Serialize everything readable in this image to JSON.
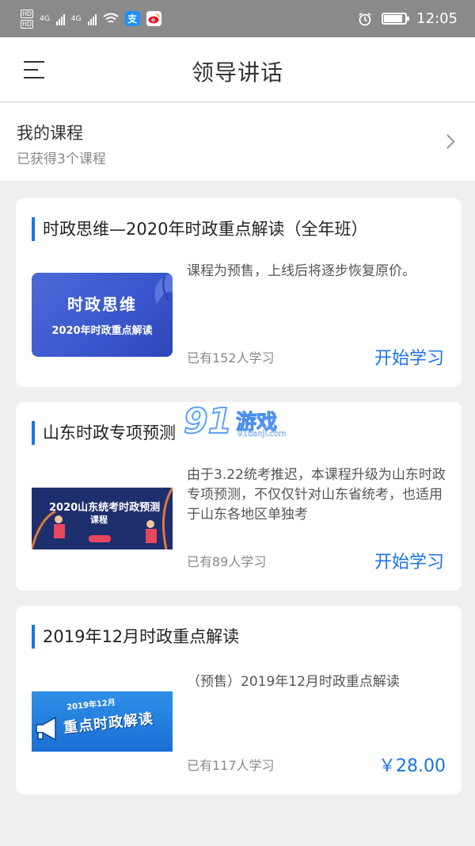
{
  "status_bar": {
    "network_labels": [
      "HD",
      "HD"
    ],
    "network_type_1": "4G",
    "network_type_2": "4G",
    "app_icon_1": "支",
    "time": "12:05"
  },
  "header": {
    "title": "领导讲话",
    "menu_icon": "hamburger-menu-icon"
  },
  "my_course": {
    "title": "我的课程",
    "subtitle": "已获得3个课程"
  },
  "courses": [
    {
      "title": "时政思维—2020年时政重点解读（全年班）",
      "thumbnail_title": "时政思维",
      "thumbnail_subtitle": "2020年时政重点解读",
      "description": "课程为预售，上线后将逐步恢复原价。",
      "learners": "已有152人学习",
      "action": "开始学习"
    },
    {
      "title": "山东时政专项预测",
      "thumbnail_title": "2020山东统考时政预测",
      "thumbnail_subtitle": "课程",
      "description": "由于3.22统考推迟，本课程升级为山东时政专项预测，不仅仅针对山东省统考，也适用于山东各地区单独考",
      "learners": "已有89人学习",
      "action": "开始学习"
    },
    {
      "title": "2019年12月时政重点解读",
      "thumbnail_year": "2019年12月",
      "thumbnail_title": "重点时政解读",
      "description": "（预售）2019年12月时政重点解读",
      "learners": "已有117人学习",
      "price": "￥28.00"
    }
  ],
  "watermark": {
    "logo": "91",
    "text": "游戏",
    "url": "91danji.com"
  },
  "colors": {
    "accent": "#1a73e8",
    "status_bar": "#8a8a8a",
    "background": "#efefef"
  }
}
